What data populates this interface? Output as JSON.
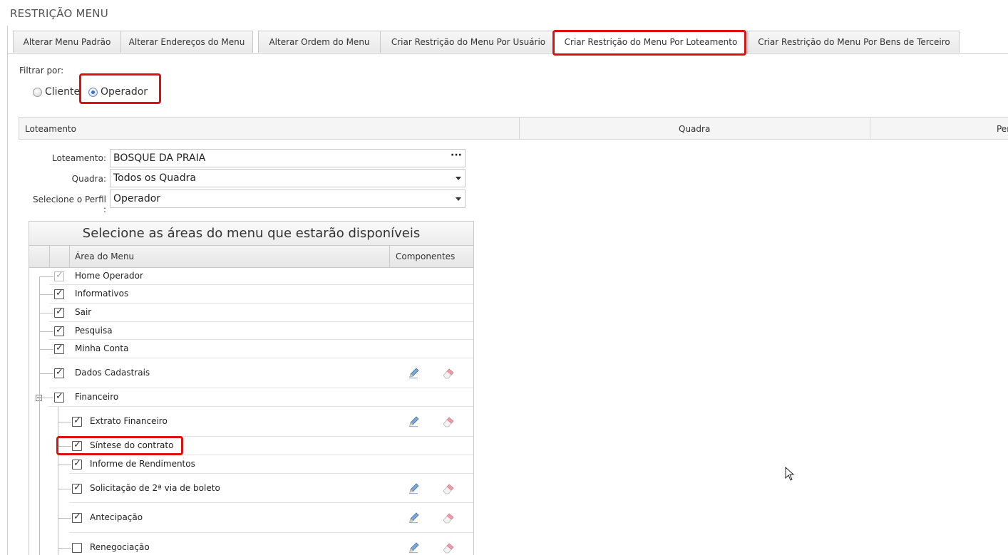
{
  "page": {
    "title": "RESTRIÇÃO MENU"
  },
  "tabs": [
    {
      "label": "Alterar Menu Padrão",
      "active": false
    },
    {
      "label": "Alterar Endereços do Menu",
      "active": false
    },
    {
      "label": "Alterar Ordem do Menu",
      "active": false
    },
    {
      "label": "Criar Restrição do Menu Por Usuário",
      "active": false
    },
    {
      "label": "Criar Restrição do Menu Por Loteamento",
      "active": true
    },
    {
      "label": "Criar Restrição do Menu Por Bens de Terceiro",
      "active": false
    }
  ],
  "filter": {
    "label": "Filtrar por:",
    "options": [
      {
        "label": "Cliente",
        "checked": false
      },
      {
        "label": "Operador",
        "checked": true
      }
    ]
  },
  "grid": {
    "columns": [
      "Loteamento",
      "Quadra",
      "Per"
    ]
  },
  "form": {
    "loteamento_label": "Loteamento:",
    "loteamento_value": "BOSQUE DA PRAIA",
    "loteamento_button": "···",
    "quadra_label": "Quadra:",
    "quadra_value": "Todos os Quadra",
    "perfil_label": "Selecione o Perfil :",
    "perfil_value": "Operador"
  },
  "menu_tree": {
    "caption": "Selecione as áreas do menu que estarão disponíveis",
    "columns": {
      "area": "Área do Menu",
      "components": "Componentes"
    },
    "items": [
      {
        "label": "Home Operador",
        "level": 0,
        "checked": true,
        "disabled": true,
        "components": false
      },
      {
        "label": "Informativos",
        "level": 0,
        "checked": true,
        "disabled": false,
        "components": false
      },
      {
        "label": "Sair",
        "level": 0,
        "checked": true,
        "disabled": false,
        "components": false
      },
      {
        "label": "Pesquisa",
        "level": 0,
        "checked": true,
        "disabled": false,
        "components": false
      },
      {
        "label": "Minha Conta",
        "level": 0,
        "checked": true,
        "disabled": false,
        "components": false
      },
      {
        "label": "Dados Cadastrais",
        "level": 0,
        "checked": true,
        "disabled": false,
        "components": true
      },
      {
        "label": "Financeiro",
        "level": 0,
        "checked": true,
        "disabled": false,
        "components": false,
        "expanded": true
      },
      {
        "label": "Extrato Financeiro",
        "level": 1,
        "checked": true,
        "disabled": false,
        "components": true
      },
      {
        "label": "Síntese do contrato",
        "level": 1,
        "checked": true,
        "disabled": false,
        "components": false
      },
      {
        "label": "Informe de Rendimentos",
        "level": 1,
        "checked": true,
        "disabled": false,
        "components": false
      },
      {
        "label": "Solicitação de 2ª via de boleto",
        "level": 1,
        "checked": true,
        "disabled": false,
        "components": true
      },
      {
        "label": "Antecipação",
        "level": 1,
        "checked": true,
        "disabled": false,
        "components": true
      },
      {
        "label": "Renegociação",
        "level": 1,
        "checked": false,
        "disabled": false,
        "components": true
      }
    ]
  },
  "colors": {
    "highlight": "#e01010",
    "accent": "#3f6fc0"
  }
}
